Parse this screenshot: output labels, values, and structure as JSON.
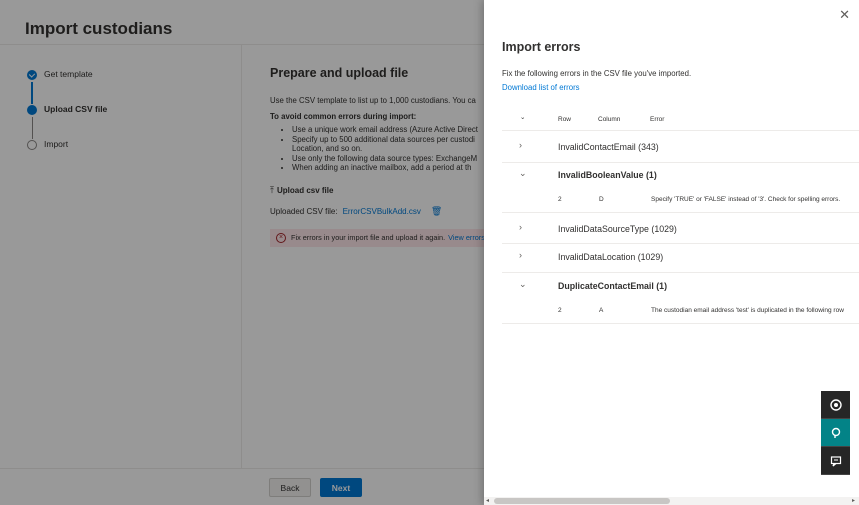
{
  "page": {
    "title": "Import custodians",
    "steps": [
      {
        "label": "Get template"
      },
      {
        "label": "Upload CSV file"
      },
      {
        "label": "Import"
      }
    ],
    "main": {
      "heading": "Prepare and upload file",
      "intro": "Use the CSV template to list up to 1,000 custodians. You ca",
      "avoid_title": "To avoid common errors during import:",
      "bullets": [
        "Use a unique work email address (Azure Active Direct",
        "Specify up to 500 additional data sources per custodi",
        "Location, and so on.",
        "Use only the following data source types: ExchangeM",
        "When adding an inactive mailbox, add a period at th"
      ],
      "upload_label": "Upload csv file",
      "uploaded_label": "Uploaded CSV file:",
      "uploaded_file": "ErrorCSVBulkAdd.csv",
      "error_text": "Fix errors in your import file and upload it again.",
      "error_link": "View errors"
    },
    "back_label": "Back",
    "next_label": "Next"
  },
  "panel": {
    "title": "Import errors",
    "description": "Fix the following errors in the CSV file you've imported.",
    "download_link": "Download list of errors",
    "columns": {
      "row": "Row",
      "column": "Column",
      "error": "Error"
    },
    "groups": [
      {
        "name": "InvalidContactEmail (343)",
        "expanded": false
      },
      {
        "name": "InvalidBooleanValue (1)",
        "expanded": true,
        "detail": {
          "row": "2",
          "column": "D",
          "error": "Specify 'TRUE' or 'FALSE' instead of '3'. Check for spelling errors."
        }
      },
      {
        "name": "InvalidDataSourceType (1029)",
        "expanded": false
      },
      {
        "name": "InvalidDataLocation (1029)",
        "expanded": false
      },
      {
        "name": "DuplicateContactEmail (1)",
        "expanded": true,
        "detail": {
          "row": "2",
          "column": "A",
          "error": "The custodian email address 'test' is duplicated in the following row"
        }
      }
    ]
  },
  "icons": {
    "close": "close-icon",
    "upload": "upload-icon",
    "trash": "trash-icon",
    "error": "error-circle-icon",
    "help": "help-icon",
    "assistant": "assistant-icon",
    "feedback": "feedback-icon"
  },
  "colors": {
    "accent": "#0078d4",
    "error_bg": "#fde7e9",
    "teal": "#038387"
  }
}
